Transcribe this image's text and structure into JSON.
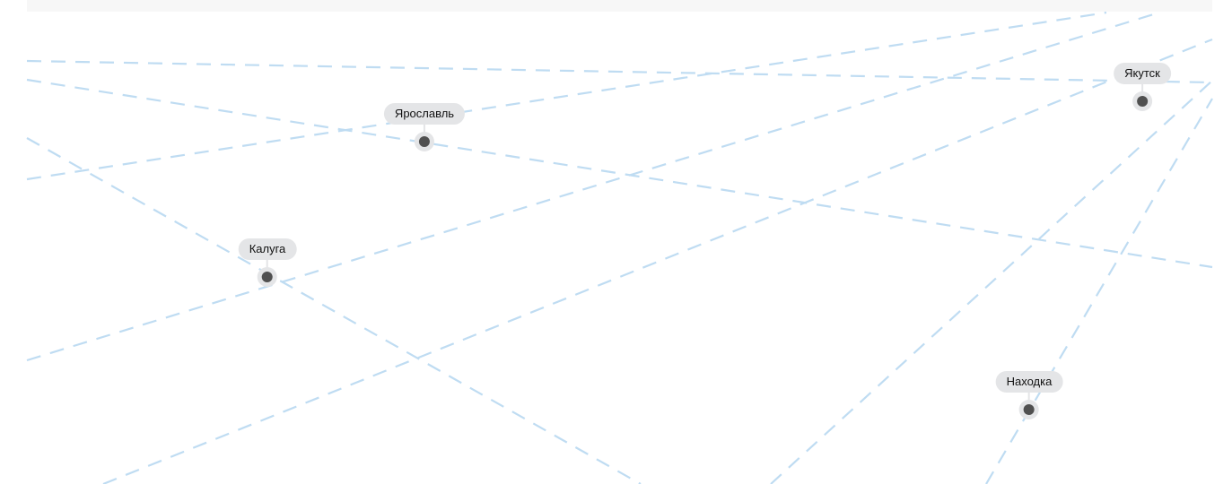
{
  "map": {
    "cities": [
      {
        "name": "Ярославль"
      },
      {
        "name": "Калуга"
      },
      {
        "name": "Якутск"
      },
      {
        "name": "Находка"
      }
    ]
  },
  "colors": {
    "route_line": "#bfdcf2",
    "label_background": "#e4e5e7",
    "marker_dot": "#505050"
  }
}
